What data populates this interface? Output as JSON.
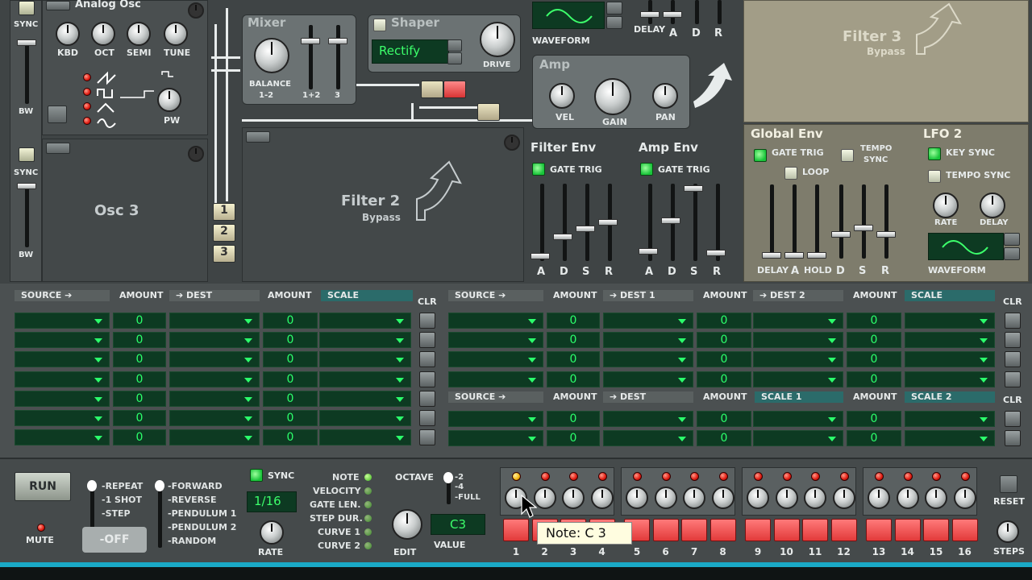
{
  "osc": {
    "sync1": "SYNC",
    "bw1": "BW",
    "sync2": "SYNC",
    "bw2": "BW",
    "analog_title": "Analog Osc",
    "knobs": [
      "KBD",
      "OCT",
      "SEMI",
      "TUNE"
    ],
    "pw": "PW",
    "osc3": "Osc 3"
  },
  "mixer": {
    "title": "Mixer",
    "balance": "BALANCE",
    "balance2": "1-2",
    "f12": "1+2",
    "f3": "3"
  },
  "shaper": {
    "title": "Shaper",
    "mode": "Rectify",
    "drive": "DRIVE"
  },
  "waveform_top": "WAVEFORM",
  "amp": {
    "title": "Amp",
    "vel": "VEL",
    "gain": "GAIN",
    "pan": "PAN"
  },
  "top_env": {
    "delay": "DELAY",
    "a": "A",
    "d": "D",
    "r": "R"
  },
  "filter3": {
    "title": "Filter 3",
    "sub": "Bypass"
  },
  "filter2": {
    "title": "Filter 2",
    "sub": "Bypass"
  },
  "routing": [
    "1",
    "2",
    "3"
  ],
  "filter_env": {
    "title": "Filter Env",
    "gate": "GATE TRIG",
    "labels": [
      "A",
      "D",
      "S",
      "R"
    ]
  },
  "amp_env": {
    "title": "Amp Env",
    "gate": "GATE TRIG",
    "labels": [
      "A",
      "D",
      "S",
      "R"
    ]
  },
  "global_env": {
    "title": "Global Env",
    "gate": "GATE TRIG",
    "tempo": "TEMPO",
    "sync": "SYNC",
    "loop": "LOOP",
    "labels": [
      "DELAY",
      "A",
      "HOLD",
      "D",
      "S",
      "R"
    ]
  },
  "lfo2": {
    "title": "LFO 2",
    "key_sync": "KEY SYNC",
    "tempo_sync": "TEMPO SYNC",
    "rate": "RATE",
    "delay": "DELAY",
    "waveform": "WAVEFORM"
  },
  "mod1": {
    "headers": [
      "SOURCE ➔",
      "AMOUNT",
      "➔ DEST",
      "AMOUNT",
      "SCALE"
    ],
    "clr": "CLR",
    "value": "0"
  },
  "mod2": {
    "headers": [
      "SOURCE ➔",
      "AMOUNT",
      "➔ DEST 1",
      "AMOUNT",
      "➔ DEST 2",
      "AMOUNT",
      "SCALE"
    ],
    "clr": "CLR"
  },
  "mod3": {
    "headers": [
      "SOURCE ➔",
      "AMOUNT",
      "➔ DEST",
      "AMOUNT",
      "SCALE 1",
      "AMOUNT",
      "SCALE 2"
    ],
    "clr": "CLR"
  },
  "seq": {
    "run": "RUN",
    "mute": "MUTE",
    "modes1": [
      "-REPEAT",
      "-1 SHOT",
      "-STEP",
      "-OFF"
    ],
    "modes2": [
      "-FORWARD",
      "-REVERSE",
      "-PENDULUM 1",
      "-PENDULUM 2",
      "-RANDOM"
    ],
    "sync": "SYNC",
    "rate_value": "1/16",
    "rate": "RATE",
    "edit_labels": [
      "NOTE",
      "VELOCITY",
      "GATE LEN.",
      "STEP DUR.",
      "CURVE 1",
      "CURVE 2"
    ],
    "octave": "OCTAVE",
    "oct_opts": [
      "-2",
      "-4",
      "-FULL"
    ],
    "edit": "EDIT",
    "value_lcd": "C3",
    "value": "VALUE",
    "reset": "RESET",
    "steps": "STEPS",
    "tooltip": "Note: C 3",
    "step_numbers": [
      "1",
      "2",
      "3",
      "4",
      "5",
      "6",
      "7",
      "8",
      "9",
      "10",
      "11",
      "12",
      "13",
      "14",
      "15",
      "16"
    ]
  }
}
